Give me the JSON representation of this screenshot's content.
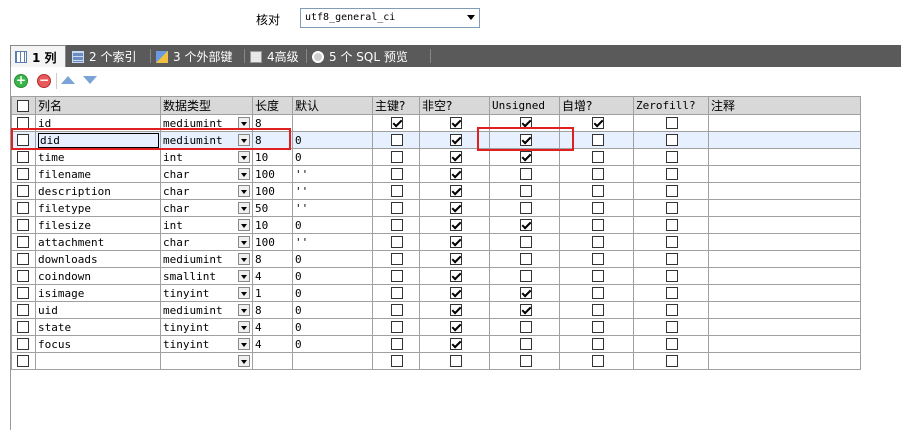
{
  "collation": {
    "label": "核对",
    "value": "utf8_general_ci"
  },
  "tabs": [
    {
      "label": "1 列",
      "active": true
    },
    {
      "label": "2 个索引"
    },
    {
      "label": "3 个外部键"
    },
    {
      "label": "4高级"
    },
    {
      "label": "5 个 SQL 预览"
    }
  ],
  "toolbar": {
    "add": "+",
    "remove": "−"
  },
  "columns": [
    "列名",
    "数据类型",
    "长度",
    "默认",
    "主键?",
    "非空?",
    "Unsigned",
    "自增?",
    "Zerofill?",
    "注释"
  ],
  "rows": [
    {
      "name": "id",
      "type": "mediumint",
      "length": "8",
      "default": "",
      "pk": true,
      "notnull": true,
      "unsigned": true,
      "ai": true,
      "zerofill": false,
      "comment": ""
    },
    {
      "name": "did",
      "type": "mediumint",
      "length": "8",
      "default": "0",
      "pk": false,
      "notnull": true,
      "unsigned": true,
      "ai": false,
      "zerofill": false,
      "comment": ""
    },
    {
      "name": "time",
      "type": "int",
      "length": "10",
      "default": "0",
      "pk": false,
      "notnull": true,
      "unsigned": true,
      "ai": false,
      "zerofill": false,
      "comment": ""
    },
    {
      "name": "filename",
      "type": "char",
      "length": "100",
      "default": "''",
      "pk": false,
      "notnull": true,
      "unsigned": false,
      "ai": false,
      "zerofill": false,
      "comment": ""
    },
    {
      "name": "description",
      "type": "char",
      "length": "100",
      "default": "''",
      "pk": false,
      "notnull": true,
      "unsigned": false,
      "ai": false,
      "zerofill": false,
      "comment": ""
    },
    {
      "name": "filetype",
      "type": "char",
      "length": "50",
      "default": "''",
      "pk": false,
      "notnull": true,
      "unsigned": false,
      "ai": false,
      "zerofill": false,
      "comment": ""
    },
    {
      "name": "filesize",
      "type": "int",
      "length": "10",
      "default": "0",
      "pk": false,
      "notnull": true,
      "unsigned": true,
      "ai": false,
      "zerofill": false,
      "comment": ""
    },
    {
      "name": "attachment",
      "type": "char",
      "length": "100",
      "default": "''",
      "pk": false,
      "notnull": true,
      "unsigned": false,
      "ai": false,
      "zerofill": false,
      "comment": ""
    },
    {
      "name": "downloads",
      "type": "mediumint",
      "length": "8",
      "default": "0",
      "pk": false,
      "notnull": true,
      "unsigned": false,
      "ai": false,
      "zerofill": false,
      "comment": ""
    },
    {
      "name": "coindown",
      "type": "smallint",
      "length": "4",
      "default": "0",
      "pk": false,
      "notnull": true,
      "unsigned": false,
      "ai": false,
      "zerofill": false,
      "comment": ""
    },
    {
      "name": "isimage",
      "type": "tinyint",
      "length": "1",
      "default": "0",
      "pk": false,
      "notnull": true,
      "unsigned": true,
      "ai": false,
      "zerofill": false,
      "comment": ""
    },
    {
      "name": "uid",
      "type": "mediumint",
      "length": "8",
      "default": "0",
      "pk": false,
      "notnull": true,
      "unsigned": true,
      "ai": false,
      "zerofill": false,
      "comment": ""
    },
    {
      "name": "state",
      "type": "tinyint",
      "length": "4",
      "default": "0",
      "pk": false,
      "notnull": true,
      "unsigned": false,
      "ai": false,
      "zerofill": false,
      "comment": ""
    },
    {
      "name": "focus",
      "type": "tinyint",
      "length": "4",
      "default": "0",
      "pk": false,
      "notnull": true,
      "unsigned": false,
      "ai": false,
      "zerofill": false,
      "comment": ""
    },
    {
      "name": "",
      "type": "",
      "length": "",
      "default": "",
      "pk": false,
      "notnull": false,
      "unsigned": false,
      "ai": false,
      "zerofill": false,
      "comment": ""
    }
  ],
  "selected_row": 1,
  "colors": {
    "tabbar": "#5a5a5a",
    "highlight": "#e02020",
    "header": "#d8d8d8"
  }
}
